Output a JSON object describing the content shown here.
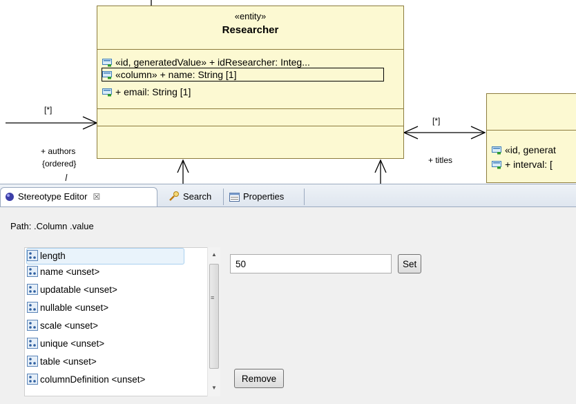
{
  "diagram": {
    "researcher": {
      "stereotype": "«entity»",
      "name": "Researcher",
      "attributes": [
        "«id, generatedValue» + idResearcher: Integ...",
        "«column» + name: String [1]",
        "+ email: String [1]"
      ]
    },
    "right_class": {
      "attributes": [
        "«id, generat",
        "+ interval: ["
      ]
    },
    "labels": {
      "left_multiplicity": "[*]",
      "authors": "+ authors",
      "ordered": "{ordered}",
      "right_multiplicity": "[*]",
      "titles": "+ titles"
    }
  },
  "tabs": [
    {
      "label": "Stereotype Editor",
      "icon": "stereotype-editor-icon",
      "close": "☒",
      "active": true
    },
    {
      "label": "Search",
      "icon": "search-icon",
      "active": false
    },
    {
      "label": "Properties",
      "icon": "properties-icon",
      "active": false
    }
  ],
  "editor": {
    "path": "Path: .Column .value",
    "properties": [
      "length",
      "name <unset>",
      "updatable <unset>",
      "nullable <unset>",
      "scale <unset>",
      "unique <unset>",
      "table <unset>",
      "columnDefinition <unset>"
    ],
    "value": "50",
    "set_label": "Set",
    "remove_label": "Remove"
  },
  "colors": {
    "class_fill": "#fcf9d2",
    "class_border": "#8c7b3c",
    "selection_fill": "#e9f3fb"
  }
}
